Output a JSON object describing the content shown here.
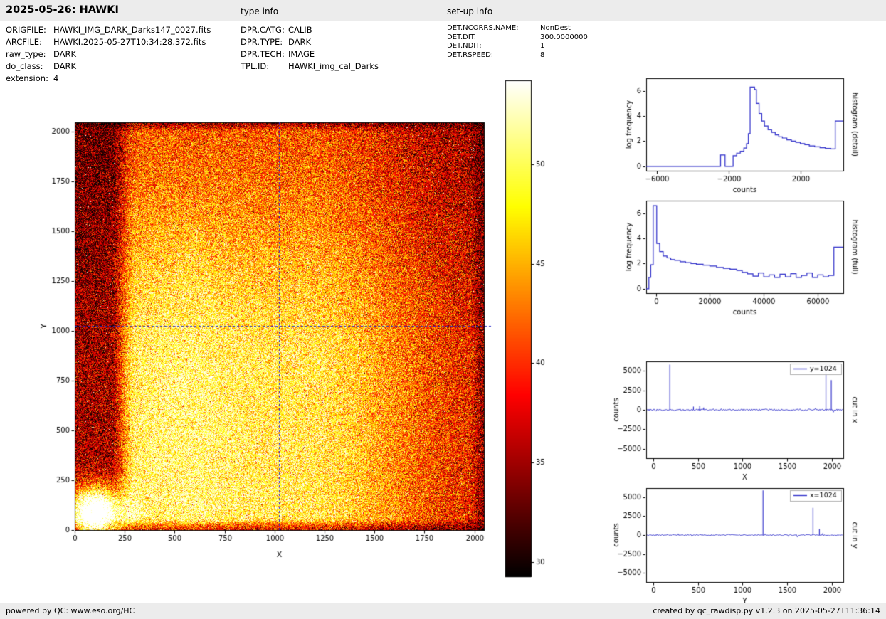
{
  "header": {
    "title": "2025-05-26: HAWKI",
    "type_info_label": "type info",
    "setup_info_label": "set-up info"
  },
  "metadata": {
    "file_info": [
      {
        "label": "ORIGFILE:",
        "value": "HAWKI_IMG_DARK_Darks147_0027.fits"
      },
      {
        "label": "ARCFILE:",
        "value": "HAWKI.2025-05-27T10:34:28.372.fits"
      },
      {
        "label": "raw_type:",
        "value": "DARK"
      },
      {
        "label": "do_class:",
        "value": "DARK"
      },
      {
        "label": "extension:",
        "value": "4"
      }
    ],
    "type_info": [
      {
        "label": "DPR.CATG:",
        "value": "CALIB"
      },
      {
        "label": "DPR.TYPE:",
        "value": "DARK"
      },
      {
        "label": "DPR.TECH:",
        "value": "IMAGE"
      },
      {
        "label": "TPL.ID:",
        "value": "HAWKI_img_cal_Darks"
      }
    ],
    "setup_info": [
      {
        "label": "DET.NCORRS.NAME:",
        "value": "NonDest"
      },
      {
        "label": "DET.DIT:",
        "value": "300.0000000"
      },
      {
        "label": "DET.NDIT:",
        "value": "1"
      },
      {
        "label": "DET.RSPEED:",
        "value": "8"
      }
    ]
  },
  "footer": {
    "left": "powered by QC: www.eso.org/HC",
    "right": "created by qc_rawdisp.py v1.2.3 on 2025-05-27T11:36:14"
  },
  "chart_data": [
    {
      "id": "main_image",
      "type": "heatmap",
      "xlabel": "X",
      "ylabel": "Y",
      "xlim": [
        0,
        2048
      ],
      "ylim": [
        0,
        2048
      ],
      "xticks": [
        0,
        250,
        500,
        750,
        1000,
        1250,
        1500,
        1750,
        2000
      ],
      "yticks": [
        0,
        250,
        500,
        750,
        1000,
        1250,
        1500,
        1750,
        2000
      ],
      "colormap": "hot",
      "value_range": [
        29.3,
        54.2
      ],
      "crosshair": {
        "x": 1024,
        "y": 1024,
        "color": "#2a2ac8"
      }
    },
    {
      "id": "colorbar",
      "type": "colorbar",
      "colormap": "hot",
      "vmin": 29.3,
      "vmax": 54.2,
      "ticks": [
        30,
        35,
        40,
        45,
        50
      ]
    },
    {
      "id": "histogram_detail",
      "type": "line",
      "right_label": "histogram (detail)",
      "xlabel": "counts",
      "ylabel": "log frequency",
      "xlim": [
        -6600,
        4400
      ],
      "ylim": [
        -0.35,
        7
      ],
      "xticks": [
        -6000,
        -2000,
        2000
      ],
      "yticks": [
        0,
        2,
        4,
        6
      ],
      "line_color": "#2a2ac8",
      "steps": [
        [
          -6600,
          0
        ],
        [
          -2450,
          0
        ],
        [
          -2450,
          0.9
        ],
        [
          -2200,
          0.9
        ],
        [
          -2200,
          0
        ],
        [
          -1750,
          0
        ],
        [
          -1750,
          0.85
        ],
        [
          -1550,
          0.85
        ],
        [
          -1550,
          1.05
        ],
        [
          -1350,
          1.05
        ],
        [
          -1350,
          1.2
        ],
        [
          -1150,
          1.2
        ],
        [
          -1150,
          1.45
        ],
        [
          -1000,
          1.45
        ],
        [
          -1000,
          1.8
        ],
        [
          -900,
          1.8
        ],
        [
          -900,
          2.6
        ],
        [
          -800,
          2.6
        ],
        [
          -800,
          6.3
        ],
        [
          -550,
          6.3
        ],
        [
          -550,
          6.1
        ],
        [
          -450,
          6.1
        ],
        [
          -450,
          5.0
        ],
        [
          -300,
          5.0
        ],
        [
          -300,
          4.2
        ],
        [
          -150,
          4.2
        ],
        [
          -150,
          3.6
        ],
        [
          0,
          3.6
        ],
        [
          0,
          3.2
        ],
        [
          200,
          3.2
        ],
        [
          200,
          2.9
        ],
        [
          400,
          2.9
        ],
        [
          400,
          2.7
        ],
        [
          600,
          2.7
        ],
        [
          600,
          2.5
        ],
        [
          800,
          2.5
        ],
        [
          800,
          2.35
        ],
        [
          1000,
          2.35
        ],
        [
          1000,
          2.25
        ],
        [
          1250,
          2.25
        ],
        [
          1250,
          2.1
        ],
        [
          1500,
          2.1
        ],
        [
          1500,
          2.0
        ],
        [
          1750,
          2.0
        ],
        [
          1750,
          1.9
        ],
        [
          2000,
          1.9
        ],
        [
          2000,
          1.8
        ],
        [
          2250,
          1.8
        ],
        [
          2250,
          1.72
        ],
        [
          2500,
          1.72
        ],
        [
          2500,
          1.62
        ],
        [
          2800,
          1.62
        ],
        [
          2800,
          1.55
        ],
        [
          3100,
          1.55
        ],
        [
          3100,
          1.48
        ],
        [
          3400,
          1.48
        ],
        [
          3400,
          1.42
        ],
        [
          3700,
          1.42
        ],
        [
          3700,
          1.38
        ],
        [
          3950,
          1.38
        ],
        [
          3950,
          3.6
        ],
        [
          4400,
          3.6
        ]
      ]
    },
    {
      "id": "histogram_full",
      "type": "line",
      "right_label": "histogram (full)",
      "xlabel": "counts",
      "ylabel": "log frequency",
      "xlim": [
        -3600,
        69500
      ],
      "ylim": [
        -0.35,
        7
      ],
      "xticks": [
        0,
        20000,
        40000,
        60000
      ],
      "yticks": [
        0,
        2,
        4,
        6
      ],
      "line_color": "#2a2ac8",
      "steps": [
        [
          -3600,
          0
        ],
        [
          -2600,
          0
        ],
        [
          -2600,
          0.9
        ],
        [
          -1900,
          0.9
        ],
        [
          -1900,
          1.9
        ],
        [
          -1000,
          1.9
        ],
        [
          -1000,
          6.6
        ],
        [
          300,
          6.6
        ],
        [
          300,
          3.6
        ],
        [
          1400,
          3.6
        ],
        [
          1400,
          2.95
        ],
        [
          2700,
          2.95
        ],
        [
          2700,
          2.6
        ],
        [
          4100,
          2.6
        ],
        [
          4100,
          2.45
        ],
        [
          5500,
          2.45
        ],
        [
          5500,
          2.32
        ],
        [
          7000,
          2.32
        ],
        [
          7000,
          2.25
        ],
        [
          9000,
          2.25
        ],
        [
          9000,
          2.15
        ],
        [
          11000,
          2.15
        ],
        [
          11000,
          2.08
        ],
        [
          13000,
          2.08
        ],
        [
          13000,
          2.0
        ],
        [
          15000,
          2.0
        ],
        [
          15000,
          1.95
        ],
        [
          17500,
          1.95
        ],
        [
          17500,
          1.88
        ],
        [
          20000,
          1.88
        ],
        [
          20000,
          1.8
        ],
        [
          22500,
          1.8
        ],
        [
          22500,
          1.7
        ],
        [
          25000,
          1.7
        ],
        [
          25000,
          1.62
        ],
        [
          27500,
          1.62
        ],
        [
          27500,
          1.55
        ],
        [
          30000,
          1.55
        ],
        [
          30000,
          1.45
        ],
        [
          32000,
          1.45
        ],
        [
          32000,
          1.3
        ],
        [
          34000,
          1.3
        ],
        [
          34000,
          1.18
        ],
        [
          36000,
          1.18
        ],
        [
          36000,
          1.0
        ],
        [
          38000,
          1.0
        ],
        [
          38000,
          1.25
        ],
        [
          40000,
          1.25
        ],
        [
          40000,
          0.95
        ],
        [
          42000,
          0.95
        ],
        [
          42000,
          1.1
        ],
        [
          44000,
          1.1
        ],
        [
          44000,
          0.9
        ],
        [
          46000,
          0.9
        ],
        [
          46000,
          1.15
        ],
        [
          48000,
          1.15
        ],
        [
          48000,
          0.95
        ],
        [
          50000,
          0.95
        ],
        [
          50000,
          1.2
        ],
        [
          52000,
          1.2
        ],
        [
          52000,
          0.9
        ],
        [
          54000,
          0.9
        ],
        [
          54000,
          1.05
        ],
        [
          56000,
          1.05
        ],
        [
          56000,
          1.25
        ],
        [
          58000,
          1.25
        ],
        [
          58000,
          0.9
        ],
        [
          60000,
          0.9
        ],
        [
          60000,
          1.1
        ],
        [
          62000,
          1.1
        ],
        [
          62000,
          0.95
        ],
        [
          64000,
          0.95
        ],
        [
          64000,
          1.05
        ],
        [
          66000,
          1.05
        ],
        [
          66000,
          3.3
        ],
        [
          69500,
          3.3
        ]
      ]
    },
    {
      "id": "cut_x",
      "type": "line",
      "right_label": "cut in x",
      "legend": "y=1024",
      "xlabel": "X",
      "ylabel": "counts",
      "xlim": [
        -80,
        2130
      ],
      "ylim": [
        -6200,
        6200
      ],
      "xticks": [
        0,
        500,
        1000,
        1500,
        2000
      ],
      "yticks": [
        -5000,
        -2500,
        0,
        2500,
        5000
      ],
      "line_color": "#2a2ac8",
      "noise_amplitude": 110,
      "spikes": [
        [
          185,
          5800
        ],
        [
          450,
          420
        ],
        [
          520,
          500
        ],
        [
          565,
          300
        ],
        [
          1935,
          5500
        ],
        [
          1995,
          3800
        ]
      ]
    },
    {
      "id": "cut_y",
      "type": "line",
      "right_label": "cut in y",
      "legend": "x=1024",
      "xlabel": "Y",
      "ylabel": "counts",
      "xlim": [
        -80,
        2130
      ],
      "ylim": [
        -6200,
        6200
      ],
      "xticks": [
        0,
        500,
        1000,
        1500,
        2000
      ],
      "yticks": [
        -5000,
        -2500,
        0,
        2500,
        5000
      ],
      "line_color": "#2a2ac8",
      "noise_amplitude": 90,
      "spikes": [
        [
          1230,
          5900
        ],
        [
          1790,
          3600
        ],
        [
          1862,
          800
        ]
      ]
    }
  ]
}
